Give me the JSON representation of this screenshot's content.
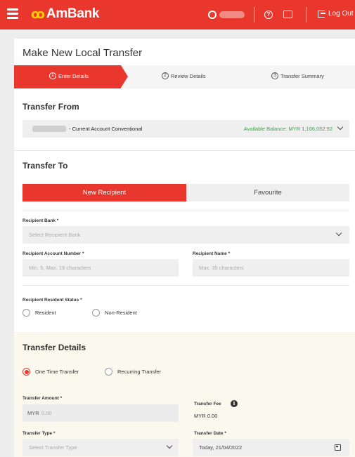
{
  "header": {
    "brand": "AmBank",
    "logout_label": "Log Out"
  },
  "page": {
    "title": "Make New Local Transfer"
  },
  "steps": [
    {
      "number": "1",
      "label": "Enter Details",
      "active": true
    },
    {
      "number": "2",
      "label": "Review Details",
      "active": false
    },
    {
      "number": "3",
      "label": "Transfer Summary",
      "active": false
    }
  ],
  "transfer_from": {
    "title": "Transfer From",
    "account_name": "- Current Account Conventional",
    "balance": "Available Balance: MYR 1,106,052.92"
  },
  "transfer_to": {
    "title": "Transfer To",
    "tab_new": "New Recipient",
    "tab_favourite": "Favourite",
    "bank_label": "Recipient Bank *",
    "bank_placeholder": "Select Recipient Bank",
    "account_label": "Recipient Account Number *",
    "account_placeholder": "Min. 5, Max. 19 characters",
    "name_label": "Recipient Name *",
    "name_placeholder": "Max. 35 characters",
    "resident_label": "Recipient Resident Status *",
    "resident_option": "Resident",
    "nonresident_option": "Non-Resident"
  },
  "transfer_details": {
    "title": "Transfer Details",
    "one_time": "One Time Transfer",
    "recurring": "Recurring Transfer",
    "amount_label": "Transfer Amount *",
    "amount_currency": "MYR",
    "amount_placeholder": "0.00",
    "fee_label": "Transfer Fee",
    "fee_value": "MYR 0.00",
    "type_label": "Transfer Type *",
    "type_placeholder": "Select Transfer Type",
    "date_label": "Transfer Date *",
    "date_value": "Today, 21/04/2022"
  },
  "colors": {
    "brand_red": "#e9372e",
    "logo_yellow": "#ffcc00",
    "balance_green": "#3fa14b"
  }
}
